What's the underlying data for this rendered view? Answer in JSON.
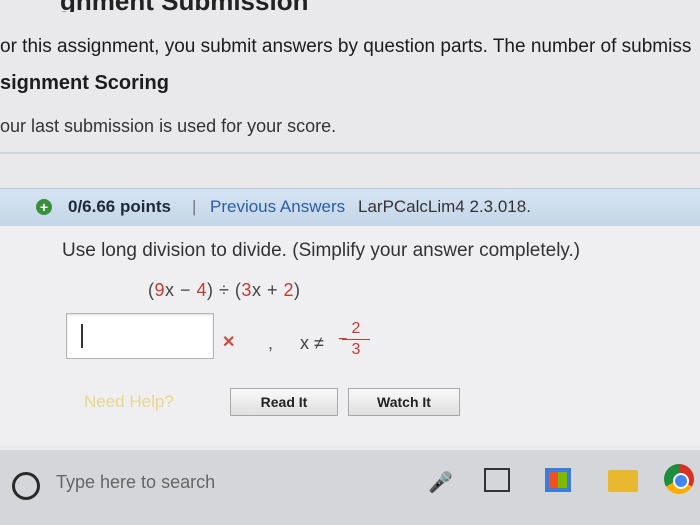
{
  "page": {
    "cut_heading": "gnment Submission",
    "policy_text": "or this assignment, you submit answers by question parts. The number of submiss",
    "scoring_heading": "signment Scoring",
    "scoring_text": "our last submission is used for your score."
  },
  "question": {
    "points": "0/6.66 points",
    "separator": "|",
    "previous_answers": "Previous Answers",
    "reference": "LarPCalcLim4 2.3.018.",
    "prompt": "Use long division to divide. (Simplify your answer completely.)",
    "expression": {
      "open": "(",
      "nine": "9",
      "x_minus": "x − ",
      "four": "4",
      "mid": ") ÷ (",
      "three": "3",
      "x_plus": "x + ",
      "two": "2",
      "close": ")"
    },
    "answer_value": "",
    "wrong_mark": "✕",
    "comma": ",",
    "x_neq": "x ≠",
    "neg": "−",
    "frac_num": "2",
    "frac_den": "3",
    "need_help": "Need Help?",
    "read_it": "Read It",
    "watch_it": "Watch It",
    "colors": {
      "accent_red": "#c43b2f",
      "link_blue": "#2a5da8",
      "correct_green": "#3a8f3a"
    }
  },
  "taskbar": {
    "search_placeholder": "Type here to search",
    "icons": [
      "search-ring-icon",
      "microphone-icon",
      "task-view-icon",
      "store-icon",
      "file-explorer-icon",
      "chrome-icon"
    ]
  }
}
